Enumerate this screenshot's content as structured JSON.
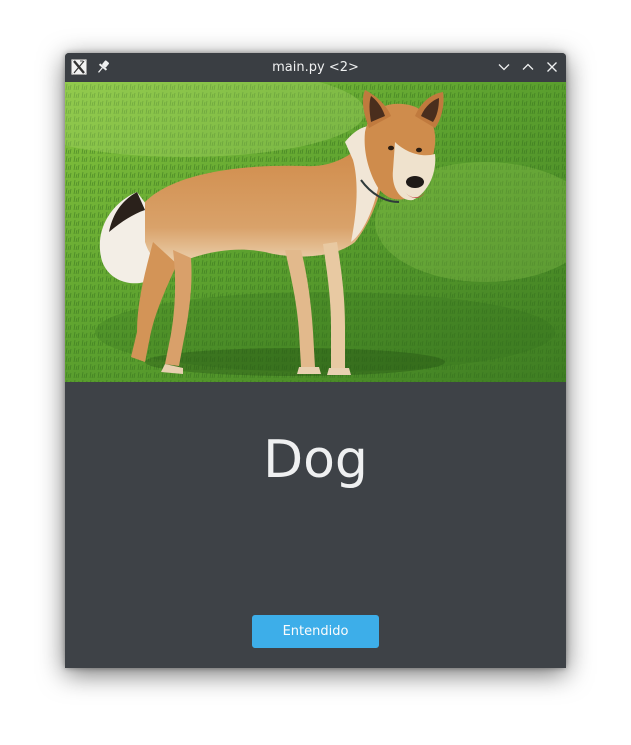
{
  "window": {
    "title": "main.py <2>",
    "icons": {
      "app": "x-app-icon",
      "pin": "pin-icon",
      "minimize": "chevron-down-icon",
      "maximize": "chevron-up-icon",
      "close": "close-icon"
    }
  },
  "content": {
    "image_subject": "dog standing on grass",
    "label": "Dog",
    "button_label": "Entendido"
  },
  "colors": {
    "window_bg": "#3e4247",
    "titlebar_bg": "#3a3e43",
    "text": "#eff0f1",
    "accent": "#3daee9"
  }
}
